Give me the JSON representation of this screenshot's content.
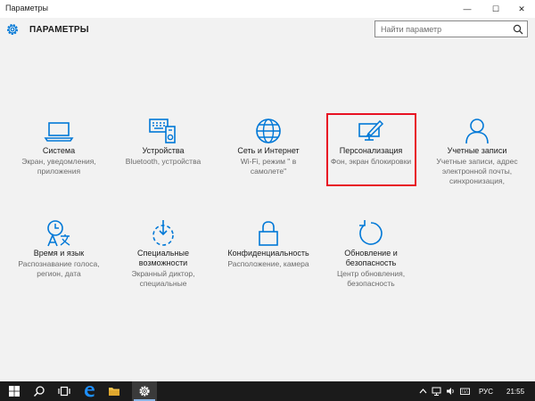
{
  "window": {
    "title": "Параметры",
    "controls": {
      "minimize": "—",
      "maximize": "☐",
      "close": "✕"
    }
  },
  "header": {
    "title": "ПАРАМЕТРЫ",
    "search_placeholder": "Найти параметр"
  },
  "tiles": [
    {
      "name": "Система",
      "desc": "Экран, уведомления, приложения",
      "icon": "laptop-icon"
    },
    {
      "name": "Устройства",
      "desc": "Bluetooth, устройства",
      "icon": "devices-icon"
    },
    {
      "name": "Сеть и Интернет",
      "desc": "Wi-Fi, режим \" в самолете\"",
      "icon": "globe-icon"
    },
    {
      "name": "Персонализация",
      "desc": "Фон, экран блокировки",
      "icon": "personalization-icon"
    },
    {
      "name": "Учетные записи",
      "desc": "Учетные записи, адрес электронной почты, синхронизация,",
      "icon": "person-icon"
    },
    {
      "name": "Время и язык",
      "desc": "Распознавание голоса, регион, дата",
      "icon": "time-language-icon"
    },
    {
      "name": "Специальные возможности",
      "desc": "Экранный диктор, специальные",
      "icon": "ease-of-access-icon"
    },
    {
      "name": "Конфиденциальность",
      "desc": "Расположение, камера",
      "icon": "lock-icon"
    },
    {
      "name": "Обновление и безопасность",
      "desc": "Центр обновления, безопасность",
      "icon": "update-icon"
    }
  ],
  "taskbar": {
    "language": "РУС",
    "time": "21:55"
  },
  "colors": {
    "accent": "#0078d7",
    "highlight": "#e81123",
    "taskbar": "#1b1b1b"
  }
}
